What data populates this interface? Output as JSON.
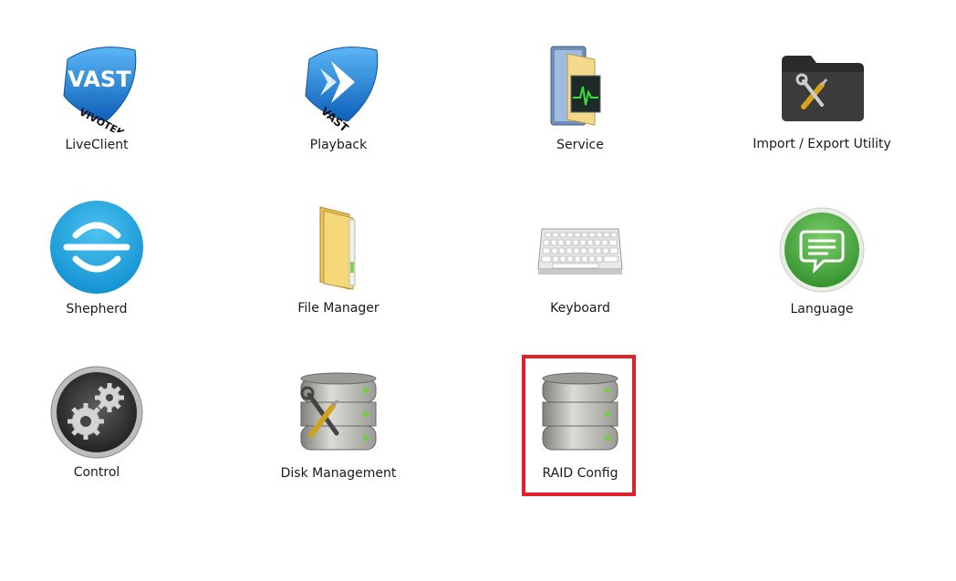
{
  "apps": [
    {
      "label": "LiveClient",
      "icon": "vast-vivotek-icon"
    },
    {
      "label": "Playback",
      "icon": "vast-playback-icon"
    },
    {
      "label": "Service",
      "icon": "service-folder-icon"
    },
    {
      "label": "Import / Export Utility",
      "icon": "tools-folder-icon"
    },
    {
      "label": "Shepherd",
      "icon": "shepherd-icon"
    },
    {
      "label": "File Manager",
      "icon": "file-manager-folder-icon"
    },
    {
      "label": "Keyboard",
      "icon": "keyboard-icon"
    },
    {
      "label": "Language",
      "icon": "chat-bubble-icon"
    },
    {
      "label": "Control",
      "icon": "gears-icon"
    },
    {
      "label": "Disk Management",
      "icon": "server-tools-icon"
    },
    {
      "label": "RAID Config",
      "icon": "server-stack-icon"
    }
  ],
  "icon_text": {
    "vast": "VAST",
    "vivotek": "VIVOTEK"
  },
  "selected": "RAID Config",
  "colors": {
    "highlight": "#e0202a",
    "vast_blue": "#1e7fd6",
    "shepherd_blue": "#1aa0dc",
    "language_green": "#3fa43a"
  }
}
